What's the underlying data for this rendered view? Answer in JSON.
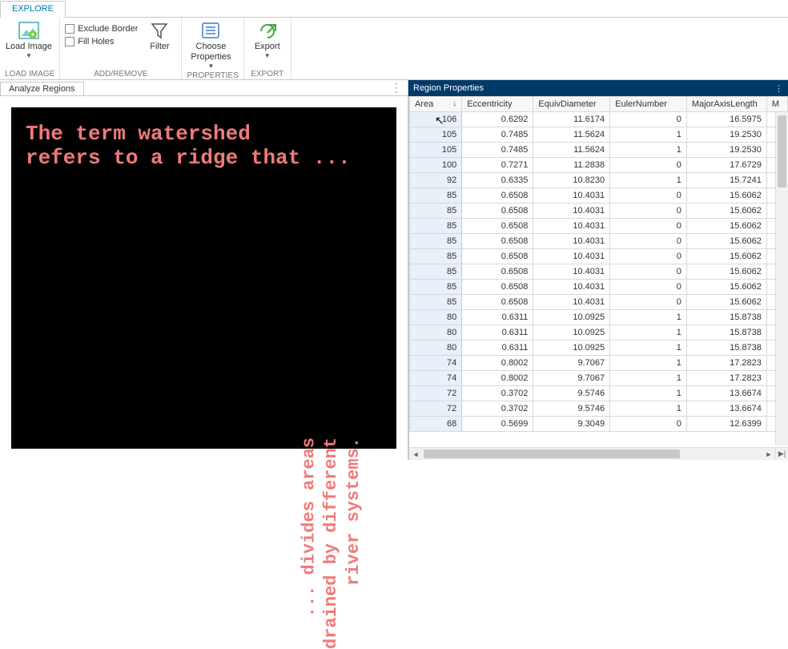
{
  "tabs": {
    "explore": "EXPLORE"
  },
  "ribbon": {
    "groups": {
      "load_image": {
        "label": "LOAD IMAGE",
        "button": "Load Image"
      },
      "add_remove": {
        "label": "ADD/REMOVE",
        "exclude_border": "Exclude Border",
        "fill_holes": "Fill Holes",
        "filter": "Filter"
      },
      "properties": {
        "label": "PROPERTIES",
        "button": "Choose Properties"
      },
      "export": {
        "label": "EXPORT",
        "button": "Export"
      }
    }
  },
  "left_panel": {
    "tab": "Analyze Regions",
    "image_text": {
      "line1": "The term watershed",
      "line2": "refers to a ridge that ...",
      "side1": "... divides areas",
      "side2": "drained by different",
      "side3": "river systems."
    }
  },
  "right_panel": {
    "title": "Region Properties",
    "columns": [
      "Area",
      "Eccentricity",
      "EquivDiameter",
      "EulerNumber",
      "MajorAxisLength",
      "M"
    ],
    "sort_col": 0,
    "rows": [
      [
        106,
        "0.6292",
        "11.6174",
        0,
        "16.5975"
      ],
      [
        105,
        "0.7485",
        "11.5624",
        1,
        "19.2530"
      ],
      [
        105,
        "0.7485",
        "11.5624",
        1,
        "19.2530"
      ],
      [
        100,
        "0.7271",
        "11.2838",
        0,
        "17.6729"
      ],
      [
        92,
        "0.6335",
        "10.8230",
        1,
        "15.7241"
      ],
      [
        85,
        "0.6508",
        "10.4031",
        0,
        "15.6062"
      ],
      [
        85,
        "0.6508",
        "10.4031",
        0,
        "15.6062"
      ],
      [
        85,
        "0.6508",
        "10.4031",
        0,
        "15.6062"
      ],
      [
        85,
        "0.6508",
        "10.4031",
        0,
        "15.6062"
      ],
      [
        85,
        "0.6508",
        "10.4031",
        0,
        "15.6062"
      ],
      [
        85,
        "0.6508",
        "10.4031",
        0,
        "15.6062"
      ],
      [
        85,
        "0.6508",
        "10.4031",
        0,
        "15.6062"
      ],
      [
        85,
        "0.6508",
        "10.4031",
        0,
        "15.6062"
      ],
      [
        80,
        "0.6311",
        "10.0925",
        1,
        "15.8738"
      ],
      [
        80,
        "0.6311",
        "10.0925",
        1,
        "15.8738"
      ],
      [
        80,
        "0.6311",
        "10.0925",
        1,
        "15.8738"
      ],
      [
        74,
        "0.8002",
        "9.7067",
        1,
        "17.2823"
      ],
      [
        74,
        "0.8002",
        "9.7067",
        1,
        "17.2823"
      ],
      [
        72,
        "0.3702",
        "9.5746",
        1,
        "13.6674"
      ],
      [
        72,
        "0.3702",
        "9.5746",
        1,
        "13.6674"
      ],
      [
        68,
        "0.5699",
        "9.3049",
        0,
        "12.6399"
      ]
    ]
  }
}
